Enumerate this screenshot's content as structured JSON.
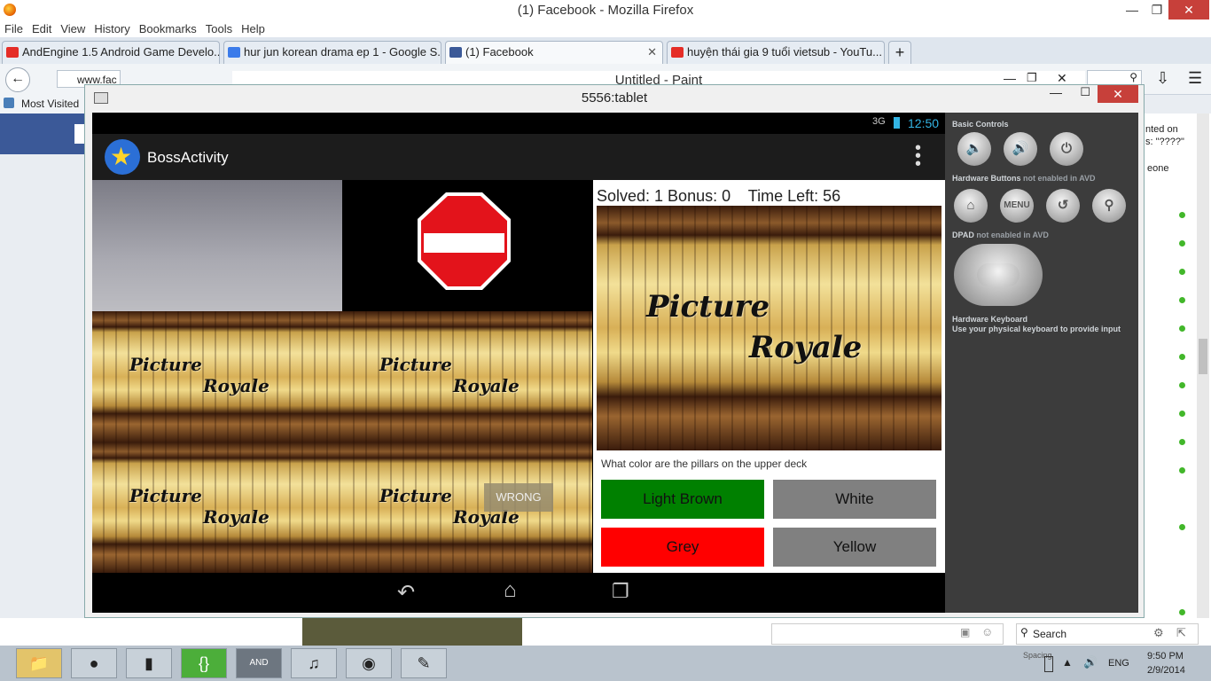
{
  "firefox": {
    "title": "(1) Facebook - Mozilla Firefox",
    "menu": [
      "File",
      "Edit",
      "View",
      "History",
      "Bookmarks",
      "Tools",
      "Help"
    ],
    "tabs": [
      {
        "label": "AndEngine 1.5 Android Game Develo...",
        "icon": "youtube-icon"
      },
      {
        "label": "hur jun korean drama ep 1 - Google S...",
        "icon": "google-icon"
      },
      {
        "label": "(1) Facebook",
        "icon": "facebook-icon",
        "active": true
      },
      {
        "label": "huyện thái gia 9 tuổi vietsub - YouTu...",
        "icon": "youtube-icon"
      }
    ],
    "url_partial": "www.fac",
    "bookmarks_label": "Most Visited",
    "search_label": "Search"
  },
  "paint": {
    "title": "Untitled - Paint"
  },
  "facebook_fragments": {
    "text1": "nted on",
    "text2": "s: \"????\"",
    "text3": "eone"
  },
  "emulator": {
    "title": "5556:tablet",
    "clock": "12:50",
    "network": "3G",
    "app_title": "BossActivity",
    "stats": "Solved: 1 Bonus: 0    Time Left: 56",
    "logo_line1": "Picture",
    "logo_line2": "Royale",
    "wrong_label": "WRONG",
    "question": "What color are the pillars on the upper deck",
    "answers": [
      {
        "label": "Light Brown",
        "color": "#008000"
      },
      {
        "label": "White",
        "color": "#808080"
      },
      {
        "label": "Grey",
        "color": "#ff0000"
      },
      {
        "label": "Yellow",
        "color": "#808080"
      }
    ],
    "controls": {
      "basic": "Basic Controls",
      "hardware_buttons": "Hardware Buttons",
      "hardware_buttons_note": "not enabled in AVD",
      "menu_label": "MENU",
      "dpad": "DPAD",
      "dpad_note": "not enabled in AVD",
      "keyboard": "Hardware Keyboard",
      "keyboard_note": "Use your physical keyboard to provide input"
    }
  },
  "taskbar": {
    "lang": "ENG",
    "time": "9:50 PM",
    "date": "2/9/2014",
    "search_label": "Search",
    "spacing_label": "Spacing"
  },
  "colors": {
    "stop_sign": "#e3131b",
    "fb_blue": "#3b5998",
    "close_red": "#c7403a"
  }
}
